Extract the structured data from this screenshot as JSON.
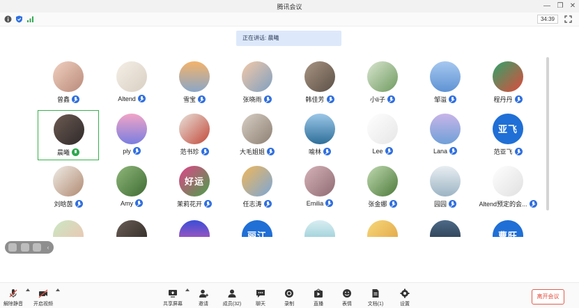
{
  "window": {
    "title": "腾讯会议"
  },
  "info": {
    "timer": "34:39"
  },
  "speaking": {
    "label": "正在讲话: 晨曦"
  },
  "participants": [
    {
      "name": "曾鑫",
      "mic": "muted"
    },
    {
      "name": "Altend",
      "mic": "muted"
    },
    {
      "name": "雪宝",
      "mic": "muted"
    },
    {
      "name": "张晓雨",
      "mic": "muted"
    },
    {
      "name": "韩佳芳",
      "mic": "muted"
    },
    {
      "name": "小li子",
      "mic": "muted"
    },
    {
      "name": "邹溢",
      "mic": "muted"
    },
    {
      "name": "程丹丹",
      "mic": "muted"
    },
    {
      "name": "晨曦",
      "mic": "active"
    },
    {
      "name": "ply",
      "mic": "muted"
    },
    {
      "name": "范书珍",
      "mic": "muted"
    },
    {
      "name": "大毛姐姐",
      "mic": "muted"
    },
    {
      "name": "喻林",
      "mic": "muted"
    },
    {
      "name": "Lee",
      "mic": "muted"
    },
    {
      "name": "Lana",
      "mic": "muted"
    },
    {
      "name": "范亚飞",
      "mic": "muted",
      "avatar_text": "亚飞"
    },
    {
      "name": "刘晗茵",
      "mic": "muted"
    },
    {
      "name": "Amy",
      "mic": "muted"
    },
    {
      "name": "茉莉花开",
      "mic": "muted",
      "avatar_text": "好运"
    },
    {
      "name": "任志涛",
      "mic": "muted"
    },
    {
      "name": "Emilia",
      "mic": "muted"
    },
    {
      "name": "张金娜",
      "mic": "muted"
    },
    {
      "name": "园园",
      "mic": "muted"
    },
    {
      "name": "Altend预定的会...",
      "mic": "muted"
    },
    {
      "name": "",
      "mic": "none"
    },
    {
      "name": "",
      "mic": "none"
    },
    {
      "name": "",
      "mic": "none"
    },
    {
      "name": "",
      "mic": "none",
      "avatar_text": "丽江"
    },
    {
      "name": "",
      "mic": "none"
    },
    {
      "name": "",
      "mic": "none"
    },
    {
      "name": "",
      "mic": "none"
    },
    {
      "name": "",
      "mic": "none",
      "avatar_text": "曹旺"
    }
  ],
  "toolbar": {
    "unmute": "解除静音",
    "video": "开启视频",
    "share": "共享屏幕",
    "invite": "邀请",
    "members": "成员(32)",
    "chat": "聊天",
    "record": "录制",
    "live": "直播",
    "reaction": "表情",
    "docs": "文档(1)",
    "settings": "设置",
    "leave": "离开会议"
  },
  "colors": {
    "accent": "#2f6fe0",
    "active_border": "#36b14a",
    "leave": "#e24b3b"
  }
}
